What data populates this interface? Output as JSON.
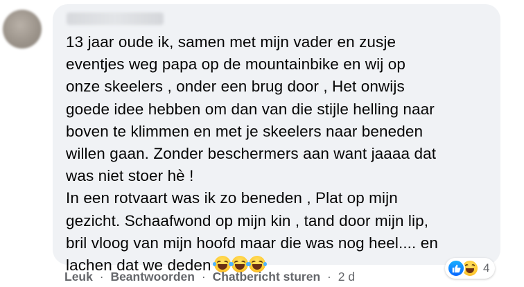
{
  "comment": {
    "text": "13 jaar oude ik, samen met mijn vader en zusje\neventjes weg papa op de mountainbike en wij op\nonze skeelers , onder een brug door , Het onwijs\ngoede idee hebben om dan van die stijle helling naar\nboven te klimmen en met je skeelers naar beneden\nwillen gaan. Zonder beschermers aan want jaaaa dat\nwas niet stoer hè !\nIn een rotvaart was ik zo beneden , Plat op mijn\ngezicht. Schaafwond op mijn kin , tand door mijn lip,\nbril vloog van mijn hoofd maar die was nog heel.... en\nlachen dat we deden",
    "trailing_emojis": [
      "face-with-tears-of-joy",
      "face-with-tears-of-joy",
      "face-with-tears-of-joy"
    ]
  },
  "reactions": {
    "icons": [
      "like-icon",
      "haha-icon"
    ],
    "count": "4",
    "colors": {
      "like": "#0866ff",
      "haha": "#ffcc33"
    }
  },
  "actions": {
    "like_label": "Leuk",
    "reply_label": "Beantwoorden",
    "message_label": "Chatbericht sturen",
    "separator": "·",
    "timestamp": "2 d"
  },
  "colors": {
    "bubble": "#f0f2f5",
    "text": "#050505",
    "secondary_text": "#65676b"
  }
}
